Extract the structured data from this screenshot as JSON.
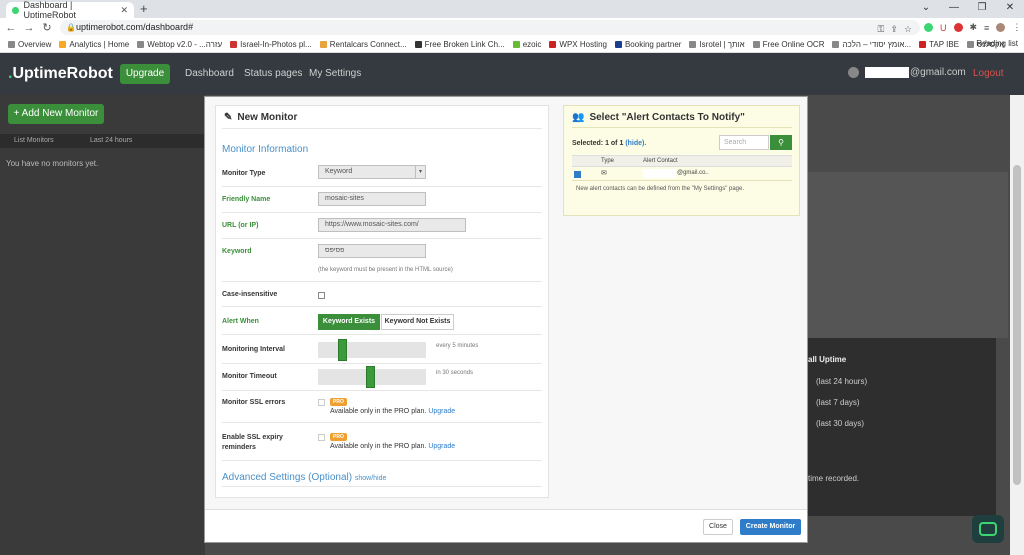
{
  "browser": {
    "tab_title": "Dashboard | UptimeRobot",
    "new_tab": "+",
    "url": "uptimerobot.com/dashboard#",
    "bookmarks": [
      "Overview",
      "Analytics | Home",
      "Webtop v2.0 - ...עזרה",
      "Israel-In-Photos pl...",
      "Rentalcars Connect...",
      "Free Broken Link Ch...",
      "ezoic",
      "WPX Hosting",
      "Booking partner",
      "Isrotel | אותך",
      "Free Online OCR",
      "אומץ יסודי – הלכה...",
      "TAP IBE",
      "אקסלנס"
    ],
    "reading_list": "Reading list"
  },
  "nav": {
    "logo": "UptimeRobot",
    "upgrade": "Upgrade",
    "dashboard": "Dashboard",
    "status_pages": "Status pages",
    "my_settings": "My Settings",
    "user_email_suffix": "@gmail.com",
    "logout": "Logout"
  },
  "background": {
    "add_monitor": "+ Add New Monitor",
    "list_tab": "List Monitors",
    "last_24": "Last 24 hours",
    "no_monitors": "You have no monitors yet.",
    "uptime_title": "all Uptime",
    "uptime_rows": [
      "(last 24 hours)",
      "(last 7 days)",
      "(last 30 days)"
    ],
    "recorded": "time recorded."
  },
  "modal": {
    "title": "New Monitor",
    "section_info": "Monitor Information",
    "monitor_type_label": "Monitor Type",
    "monitor_type_value": "Keyword",
    "friendly_name_label": "Friendly Name",
    "friendly_name_value": "mosaic-sites",
    "url_label": "URL (or IP)",
    "url_value": "https://www.mosaic-sites.com/",
    "keyword_label": "Keyword",
    "keyword_value": "פסיפס",
    "keyword_hint": "(the keyword must be present in the HTML source)",
    "case_label": "Case-insensitive",
    "alert_when_label": "Alert When",
    "keyword_exists": "Keyword Exists",
    "keyword_not_exists": "Keyword Not Exists",
    "interval_label": "Monitoring Interval",
    "interval_value": "every 5 minutes",
    "interval_fraction": 0.2,
    "timeout_label": "Monitor Timeout",
    "timeout_value": "in 30 seconds",
    "timeout_fraction": 0.48,
    "ssl_label": "Monitor SSL errors",
    "ssl_expiry_label_1": "Enable SSL expiry",
    "ssl_expiry_label_2": "reminders",
    "pro_badge": "PRO",
    "pro_text": "Available only in the PRO plan.",
    "upgrade_link": "Upgrade",
    "advanced": "Advanced Settings (Optional)",
    "show_hide": "show/hide",
    "close": "Close",
    "create": "Create Monitor"
  },
  "alerts": {
    "title": "Select \"Alert Contacts To Notify\"",
    "selected": "Selected: 1 of 1",
    "hide": "(hide).",
    "search_placeholder": "Search",
    "col_type": "Type",
    "col_contact": "Alert Contact",
    "contact_suffix": "@gmail.co..",
    "note": "New alert contacts can be defined from the \"My Settings\" page."
  },
  "colors": {
    "brand_green": "#3bd671",
    "button_green": "#3b8f3b",
    "primary_blue": "#2f7dc9",
    "pro_orange": "#f0a030"
  }
}
